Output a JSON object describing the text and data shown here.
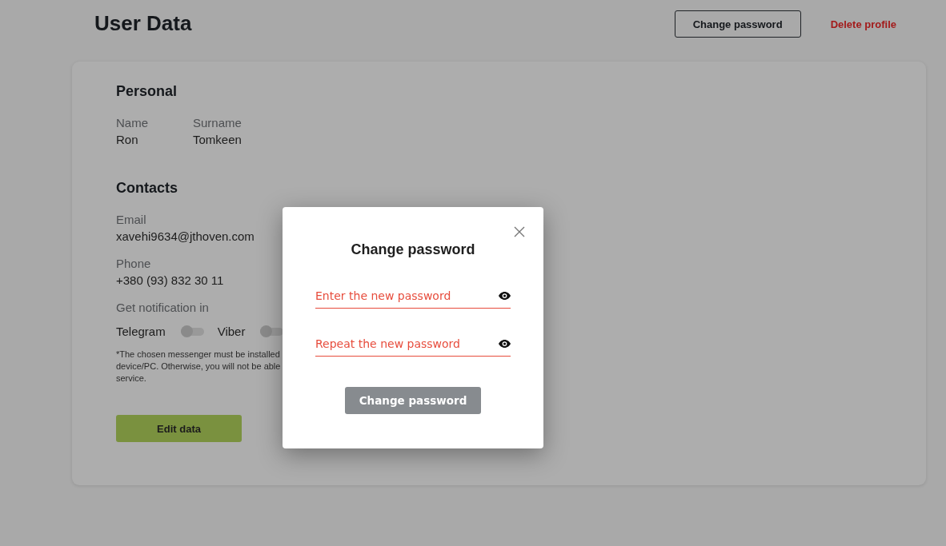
{
  "header": {
    "title": "User Data",
    "change_password_button": "Change password",
    "delete_profile_link": "Delete profile"
  },
  "personal": {
    "heading": "Personal",
    "fields": [
      {
        "label": "Name",
        "value": "Ron"
      },
      {
        "label": "Surname",
        "value": "Tomkeen"
      }
    ]
  },
  "contacts": {
    "heading": "Contacts",
    "fields": [
      {
        "label": "Email",
        "value": "xavehi9634@jthoven.com"
      },
      {
        "label": "Phone",
        "value": "+380 (93) 832 30 11"
      }
    ],
    "notification_label": "Get notification in",
    "messengers": [
      {
        "label": "Telegram",
        "on": false
      },
      {
        "label": "Viber",
        "on": false
      }
    ],
    "note_lines": [
      "*The chosen messenger must be installed",
      "device/PC. Otherwise, you will not be able",
      "service."
    ]
  },
  "edit_button": "Edit data",
  "modal": {
    "title": "Change password",
    "fields": [
      {
        "placeholder": "Enter the new password"
      },
      {
        "placeholder": "Repeat the new password"
      }
    ],
    "submit_button": "Change password"
  }
}
